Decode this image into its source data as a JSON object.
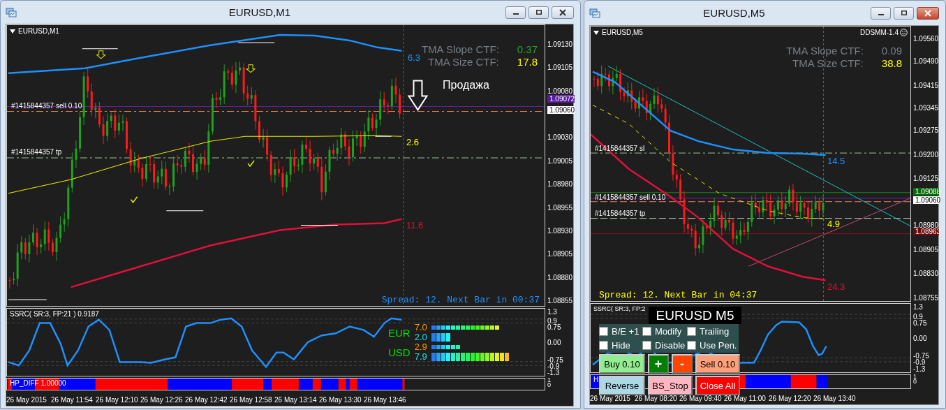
{
  "windows": [
    {
      "title": "EURUSD,M1",
      "active": false,
      "symbol": "EURUSD,M1",
      "tma": [
        {
          "label": "TMA Slope CTF:",
          "value": "0.37",
          "color": "#2e9e2e"
        },
        {
          "label": "TMA Size CTF:",
          "value": "17.8",
          "color": "#ffff00"
        }
      ],
      "band_labels": [
        {
          "text": "6.3",
          "color": "#1e90ff"
        },
        {
          "text": "2.6",
          "color": "#ffff00"
        },
        {
          "text": "11.6",
          "color": "#e0102f"
        }
      ],
      "signal": "Продажа",
      "order_labels": [
        "#1415844357 sell 0.10",
        "#1415844357 tp"
      ],
      "price_axis": [
        "1.09130",
        "1.09105",
        "1.09080",
        "1.09030",
        "1.09005",
        "1.08980",
        "1.08955",
        "1.08930",
        "1.08905",
        "1.08880",
        "1.08855"
      ],
      "price_tags": [
        {
          "text": "1.09072",
          "color": "#5b1a9e"
        },
        {
          "text": "1.09060",
          "color": "#ffffff"
        }
      ],
      "spread": {
        "text": "Spread: 12. Next Bar in 00:37",
        "color": "#1e90ff"
      },
      "ssrc": {
        "label": "SSRC( SR:3, FP:21 ) 0.9187",
        "axis": [
          "1.3",
          "0.9",
          "0.75",
          "0.00",
          "-0.75",
          "-0.9",
          "-1.3"
        ]
      },
      "strength": [
        {
          "currency": "EUR",
          "rows": [
            {
              "value": "7.0"
            },
            {
              "value": "2.0"
            }
          ]
        },
        {
          "currency": "USD",
          "rows": [
            {
              "value": "2.9"
            },
            {
              "value": "7.9"
            }
          ]
        }
      ],
      "hp_diff": {
        "label": "HP_DIFF 1.00000",
        "axis": [
          "1",
          "0"
        ]
      },
      "time_axis": [
        "26 May 2015",
        "26 May 11:54",
        "26 May 12:10",
        "26 May 12:26",
        "26 May 12:42",
        "26 May 12:58",
        "26 May 13:14",
        "26 May 13:30",
        "26 May 13:46"
      ]
    },
    {
      "title": "EURUSD,M5",
      "active": true,
      "symbol": "EURUSD,M5",
      "badge": "DDSMM-1.4",
      "tma": [
        {
          "label": "TMA Slope CTF:",
          "value": "0.09",
          "color": "#777e88"
        },
        {
          "label": "TMA Size CTF:",
          "value": "38.8",
          "color": "#ffff00"
        }
      ],
      "band_labels": [
        {
          "text": "14.5",
          "color": "#1e90ff"
        },
        {
          "text": "4.9",
          "color": "#ffff00"
        },
        {
          "text": "24.3",
          "color": "#e0102f"
        }
      ],
      "order_labels": [
        "#1415844357 sl",
        "#1415844357 sell 0.10",
        "#1415844357 tp"
      ],
      "price_axis": [
        "1.09560",
        "1.09490",
        "1.09415",
        "1.09345",
        "1.09275",
        "1.09200",
        "1.09125",
        "1.08980",
        "1.08905",
        "1.08830",
        "1.08755"
      ],
      "price_tags": [
        {
          "text": "1.09088",
          "color": "#0a6a0a"
        },
        {
          "text": "1.09060",
          "color": "#ffffff"
        },
        {
          "text": "1.08963",
          "color": "#6a0a0a"
        }
      ],
      "spread": {
        "text": "Spread: 12. Next Bar in 04:37",
        "color": "#ffff00"
      },
      "ssrc": {
        "label": "SSRC( SR:3, FP:2",
        "axis": [
          "1.3",
          "0.9",
          "0.75",
          "0.00",
          "-0.75",
          "-0.9",
          "-1.3"
        ]
      },
      "hp_diff": {
        "label": "H",
        "axis": [
          "1",
          "0"
        ]
      },
      "time_axis": [
        "26 May 2015",
        "26 May 08:20",
        "26 May 09:40",
        "26 May 11:00",
        "26 May 12:20",
        "26 May 13:40"
      ],
      "trade_panel": {
        "title": "EURUSD  M5",
        "options": [
          {
            "label": "B/E +1",
            "checked": false
          },
          {
            "label": "Modify",
            "checked": false
          },
          {
            "label": "Trailing",
            "checked": false
          },
          {
            "label": "Hide",
            "checked": false
          },
          {
            "label": "Disable",
            "checked": false
          },
          {
            "label": "Use Pen.",
            "checked": false
          }
        ],
        "buttons": [
          {
            "label": "Buy 0.10",
            "color": "#90ee90"
          },
          {
            "label": "+",
            "color": "#008000"
          },
          {
            "label": "-",
            "color": "#ff4500"
          },
          {
            "label": "Sell 0.10",
            "color": "#ffa07a"
          },
          {
            "label": "Reverse",
            "color": "#add8e6"
          },
          {
            "label": "BS_Stop",
            "color": "#ffb6c1"
          },
          {
            "label": "Close All",
            "color": "#ff0000"
          }
        ]
      }
    }
  ]
}
